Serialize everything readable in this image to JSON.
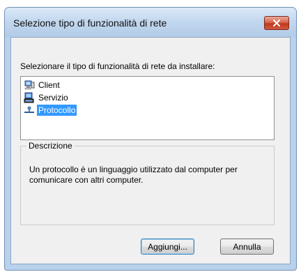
{
  "dialog": {
    "title": "Selezione tipo di funzionalità di rete",
    "prompt": "Selezionare il tipo di funzionalità di rete da installare:",
    "items": [
      {
        "label": "Client",
        "icon": "client-icon",
        "selected": false
      },
      {
        "label": "Servizio",
        "icon": "service-icon",
        "selected": false
      },
      {
        "label": "Protocollo",
        "icon": "protocol-icon",
        "selected": true
      }
    ],
    "description": {
      "title": "Descrizione",
      "text": "Un protocollo è un linguaggio utilizzato dal computer per comunicare con altri computer."
    },
    "buttons": {
      "add": "Aggiungi...",
      "cancel": "Annulla"
    }
  },
  "colors": {
    "selection": "#3399ff",
    "close_button": "#c0391c",
    "window_frame": "#b9d1ea"
  }
}
